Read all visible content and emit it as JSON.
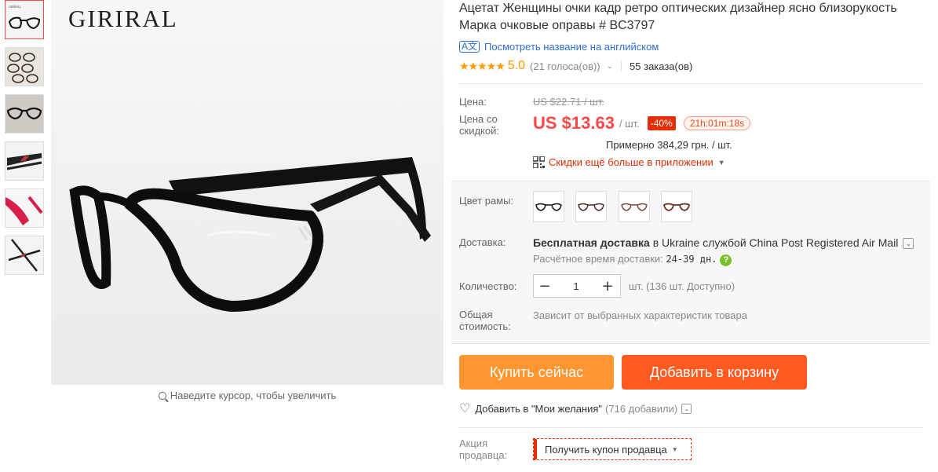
{
  "brand": "GIRIRAL",
  "zoom_hint": "Наведите курсор, чтобы увеличить",
  "product": {
    "title": "Ацетат Женщины очки кадр ретро оптических дизайнер ясно близорукость Марка очковые оправы # BC3797",
    "translate_link": "Посмотреть название на английском",
    "rating_score": "5.0",
    "votes": "(21 голоса(ов))",
    "orders": "55 заказа(ов)"
  },
  "price": {
    "label": "Цена:",
    "old": "US $22.71 / шт.",
    "discount_label": "Цена со скидкой:",
    "current": "US $13.63",
    "per_unit": "/ шт.",
    "discount": "-40%",
    "timer": "21h:01m:18s",
    "approx": "Примерно 384,29 грн. / шт.",
    "app_promo": "Скидки ещё больше в приложении"
  },
  "options": {
    "color_label": "Цвет рамы:",
    "shipping_label": "Доставка:",
    "shipping_free": "Бесплатная доставка",
    "shipping_to": " в Ukraine службой China Post Registered Air Mail",
    "eta_label": "Расчётное время доставки:",
    "eta_days": "24-39 дн.",
    "quantity_label": "Количество:",
    "quantity_value": "1",
    "availability": "шт. (136 шт. Доступно)",
    "total_label": "Общая стоимость:",
    "total_value": "Зависит от выбранных характеристик товара"
  },
  "actions": {
    "buy_now": "Купить сейчас",
    "add_to_cart": "Добавить в корзину",
    "wishlist": "Добавить в \"Мои желания\"",
    "wishlist_count": "(716 добавили)",
    "seller_promo_label": "Акция продавца:",
    "seller_coupon": "Получить купон продавца"
  },
  "colors": {
    "accent": "#ff4747",
    "buy": "#ff9632",
    "cart": "#ff5a1f",
    "link": "#2e6fc9",
    "star": "#ff9900"
  }
}
